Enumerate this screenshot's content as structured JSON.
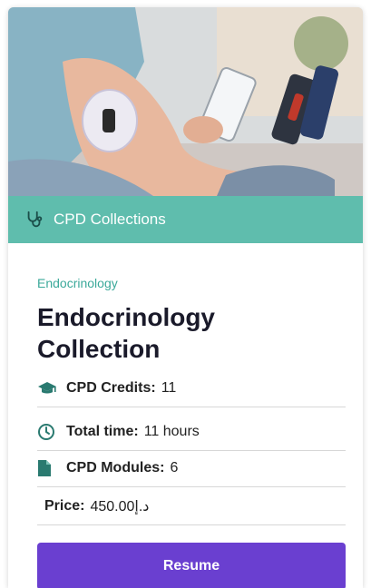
{
  "banner": {
    "label": "CPD Collections",
    "icon": "stethoscope-icon"
  },
  "card": {
    "category": "Endocrinology",
    "title": "Endocrinology Collection",
    "details": [
      {
        "icon": "graduation-cap-icon",
        "key": "CPD Credits:",
        "value": "11"
      },
      {
        "icon": "clock-icon",
        "key": "Total time:",
        "value": "11 hours"
      },
      {
        "icon": "document-icon",
        "key": "CPD Modules:",
        "value": "6"
      }
    ],
    "price": {
      "key": "Price:",
      "value": "450.00د.إ"
    },
    "button_label": "Resume"
  },
  "colors": {
    "banner": "#5fbdad",
    "accent_text": "#3ba99a",
    "button": "#6a3fd0",
    "icon": "#2a7a70"
  }
}
